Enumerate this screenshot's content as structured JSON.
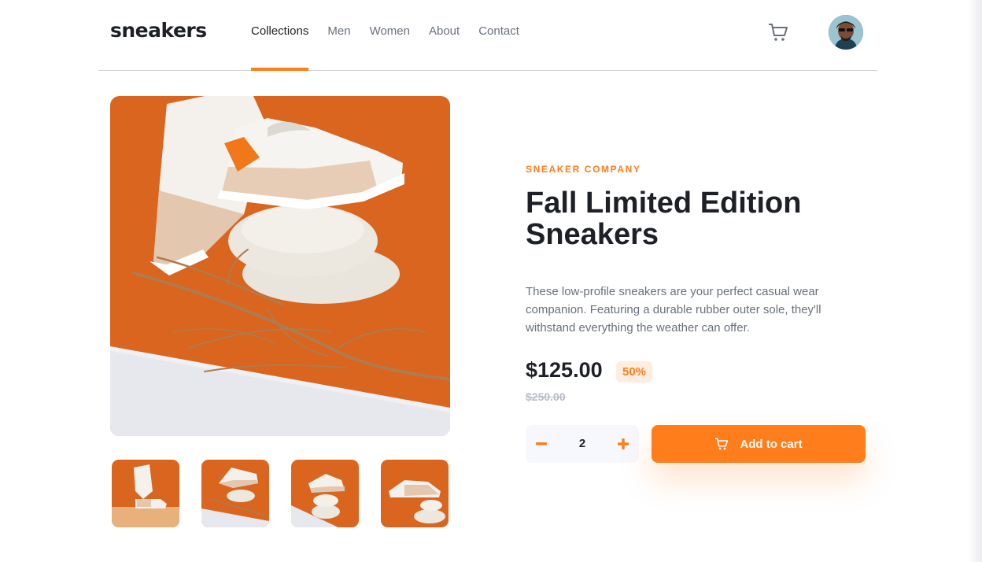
{
  "header": {
    "logo": "sneakers",
    "nav": [
      "Collections",
      "Men",
      "Women",
      "About",
      "Contact"
    ],
    "active_nav": "Collections",
    "icons": {
      "cart": "cart-icon",
      "avatar": "user-avatar"
    }
  },
  "gallery": {
    "main_image": "orange-sneakers-on-stones",
    "thumbnails": [
      "thumbnail-1",
      "thumbnail-2",
      "thumbnail-3",
      "thumbnail-4"
    ]
  },
  "product": {
    "company": "SNEAKER COMPANY",
    "title": "Fall Limited Edition Sneakers",
    "description": "These low-profile sneakers are your perfect casual wear companion. Featuring a durable rubber outer sole, they'll withstand everything the weather can offer.",
    "price": "$125.00",
    "discount": "50%",
    "original_price": "$250.00"
  },
  "cart_controls": {
    "quantity": "2",
    "add_to_cart_label": "Add to cart"
  },
  "colors": {
    "accent": "#ff7e1b",
    "accent_pale": "#ffede0",
    "text_dark": "#1d2026",
    "text_muted": "#69707d",
    "text_faint": "#b6bcc8",
    "qty_background": "#f6f8fd"
  }
}
